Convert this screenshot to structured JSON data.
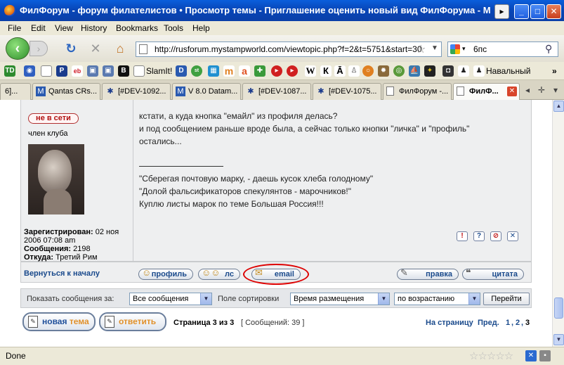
{
  "window": {
    "title": "ФилФорум - форум филателистов • Просмотр темы - Приглашение оценить новый вид ФилФорума - Moz",
    "more": "▸",
    "minimize": "_",
    "maximize": "□",
    "close": "✕"
  },
  "menu": [
    "File",
    "Edit",
    "View",
    "History",
    "Bookmarks",
    "Tools",
    "Help"
  ],
  "nav": {
    "url": "http://rusforum.mystampworld.com/viewtopic.php?f=2&t=5751&start=30",
    "search_value": "6пс"
  },
  "bookmarks": {
    "labels": [
      "SlamIt!",
      "Навальный"
    ],
    "overflow": "»"
  },
  "tabs": [
    {
      "label": "6]...",
      "icon": "page-icon"
    },
    {
      "label": "Qantas CRs...",
      "icon": "jira-icon"
    },
    {
      "label": "[#DEV-1092...",
      "icon": "bug-icon"
    },
    {
      "label": "V 8.0 Datam...",
      "icon": "jira-icon"
    },
    {
      "label": "[#DEV-1087...",
      "icon": "bug-icon"
    },
    {
      "label": "[#DEV-1075...",
      "icon": "bug-icon"
    },
    {
      "label": "ФилФорум -...",
      "icon": "page-icon"
    },
    {
      "label": "ФилФ...",
      "icon": "page-icon",
      "active": true
    }
  ],
  "post": {
    "status": "не в сети",
    "rank": "член клуба",
    "registered_label": "Зарегистрирован:",
    "registered_value": "02 ноя",
    "registered_value2": "2006 07:08 am",
    "posts_label": "Сообщения:",
    "posts_value": "2198",
    "from_label": "Откуда:",
    "from_value": "Третий Рим",
    "lines": [
      "кстати, а куда кнопка \"емайл\" из профиля делась?",
      "и под сообщением раньше вроде была, а сейчас только кнопки \"личка\" и \"профиль\"",
      "остались..."
    ],
    "signature": [
      "\"Сберегая почтовую марку, - даешь кусок хлеба голодному\"",
      "\"Долой фальсификаторов спекулянтов - марочников!\"",
      "Куплю листы марок по теме Большая Россия!!!"
    ],
    "action_icons": [
      "!",
      "?",
      "⊘",
      "✕"
    ],
    "back_to_top": "Вернуться к началу",
    "buttons": {
      "profile": "профиль",
      "pm": "лс",
      "email": "email",
      "edit": "правка",
      "quote": "цитата"
    }
  },
  "filter": {
    "show_label": "Показать сообщения за:",
    "show_value": "Все сообщения",
    "sort_label": "Поле сортировки",
    "sort_value": "Время размещения",
    "order_value": "по возрастанию",
    "go_label": "Перейти"
  },
  "footer": {
    "new_topic_a": "новая",
    "new_topic_b": "тема",
    "reply": "ответить",
    "page_info_bold": "Страница 3 из 3",
    "page_info_rest": "[ Сообщений: 39 ]",
    "pager_label": "На страницу",
    "pager_prev": "Пред.",
    "pages": [
      "1",
      "2",
      "3"
    ]
  },
  "status": {
    "text": "Done",
    "stars": "☆☆☆☆☆"
  }
}
